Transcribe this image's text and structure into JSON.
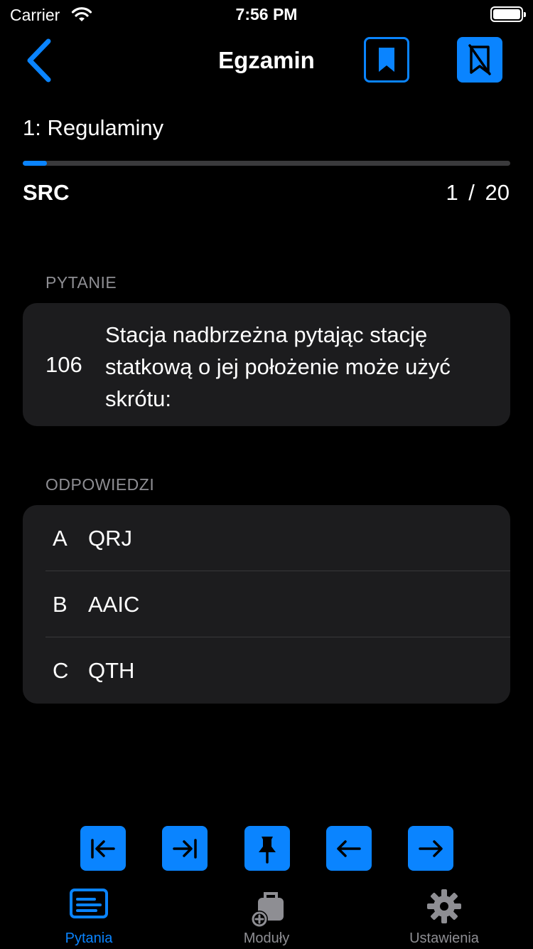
{
  "status_bar": {
    "carrier": "Carrier",
    "time": "7:56 PM"
  },
  "nav": {
    "title": "Egzamin"
  },
  "category": "1:  Regulaminy",
  "progress": {
    "fraction": 0.05
  },
  "module_code": "SRC",
  "counter": "1  /  20",
  "question_section_label": "PYTANIE",
  "question": {
    "number": "106",
    "text": "Stacja nadbrzeżna pytając stację statkową o jej położenie może użyć skrótu:"
  },
  "answers_section_label": "ODPOWIEDZI",
  "answers": [
    {
      "letter": "A",
      "text": "QRJ"
    },
    {
      "letter": "B",
      "text": "AAIC"
    },
    {
      "letter": "C",
      "text": "QTH"
    }
  ],
  "tabs": [
    {
      "label": "Pytania",
      "icon": "questions-icon",
      "active": true
    },
    {
      "label": "Moduły",
      "icon": "modules-icon",
      "active": false
    },
    {
      "label": "Ustawienia",
      "icon": "gear-icon",
      "active": false
    }
  ],
  "colors": {
    "accent": "#0a84ff",
    "inactive": "#8e8e93",
    "card": "#1c1c1e",
    "background": "#000000"
  }
}
